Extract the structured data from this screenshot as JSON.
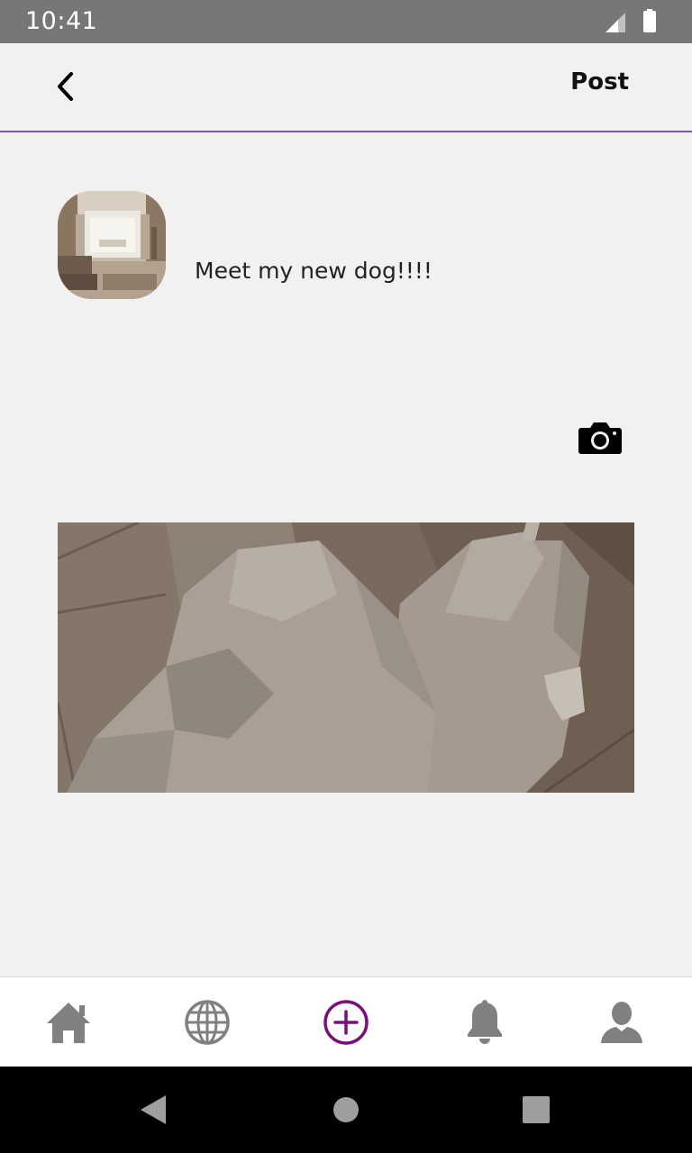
{
  "status_bar": {
    "time": "10:41",
    "icons": [
      "signal-icon",
      "battery-icon"
    ]
  },
  "app_bar": {
    "back_icon": "chevron-left-icon",
    "post_label": "Post",
    "divider_color": "#7b4fd8"
  },
  "composer": {
    "avatar_icon": "room-photo",
    "text": "Meet my new dog!!!!",
    "camera_icon": "camera-icon",
    "attached_image": "dog-photo"
  },
  "bottom_nav": {
    "active_color": "#7a0f7a",
    "inactive_color": "#808080",
    "items": [
      {
        "icon": "home-icon",
        "active": false
      },
      {
        "icon": "globe-icon",
        "active": false
      },
      {
        "icon": "add-circle-icon",
        "active": true
      },
      {
        "icon": "bell-icon",
        "active": false
      },
      {
        "icon": "person-icon",
        "active": false
      }
    ]
  },
  "system_nav": {
    "icons": [
      "back-triangle-icon",
      "home-circle-icon",
      "recents-square-icon"
    ]
  }
}
